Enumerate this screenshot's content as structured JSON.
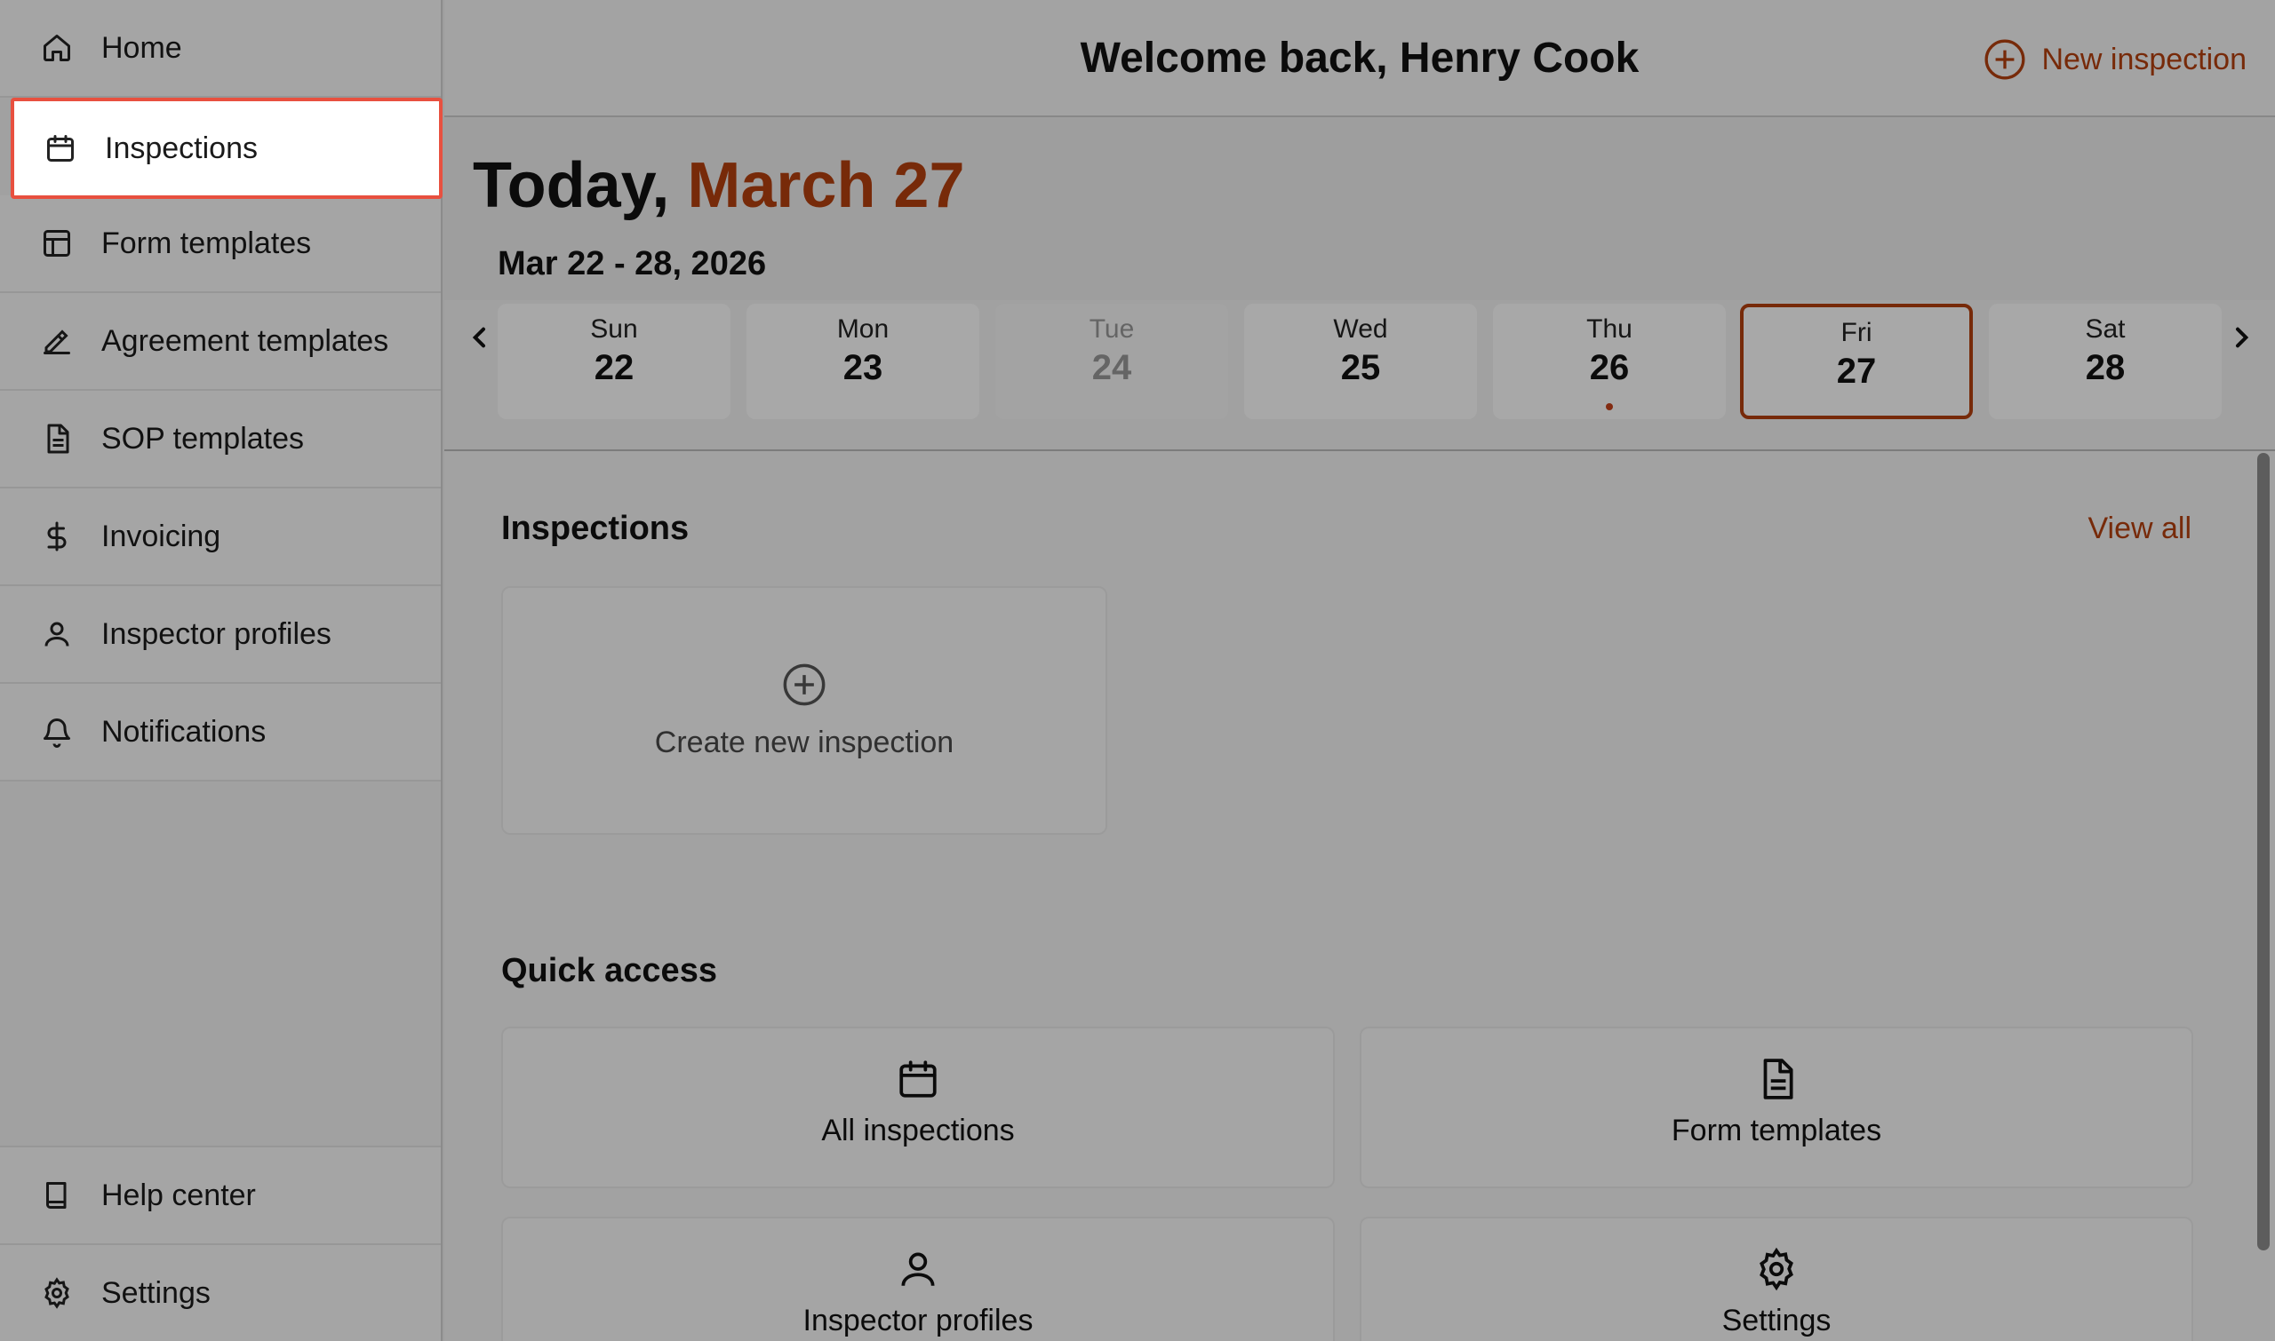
{
  "sidebar": {
    "items": [
      {
        "label": "Home",
        "icon": "home-icon"
      },
      {
        "label": "Inspections",
        "icon": "calendar-icon",
        "active": true
      },
      {
        "label": "Form templates",
        "icon": "layout-icon"
      },
      {
        "label": "Agreement templates",
        "icon": "signature-icon"
      },
      {
        "label": "SOP templates",
        "icon": "document-icon"
      },
      {
        "label": "Invoicing",
        "icon": "dollar-icon"
      },
      {
        "label": "Inspector profiles",
        "icon": "user-icon"
      },
      {
        "label": "Notifications",
        "icon": "bell-icon"
      }
    ],
    "bottom_items": [
      {
        "label": "Help center",
        "icon": "book-icon"
      },
      {
        "label": "Settings",
        "icon": "gear-icon"
      }
    ]
  },
  "header": {
    "welcome": "Welcome back, Henry Cook",
    "new_inspection_label": "New inspection"
  },
  "today": {
    "prefix": "Today,",
    "date": "March 27"
  },
  "week": {
    "range": "Mar 22 - 28, 2026",
    "days": [
      {
        "name": "Sun",
        "date": "22",
        "state": "normal"
      },
      {
        "name": "Mon",
        "date": "23",
        "state": "normal"
      },
      {
        "name": "Tue",
        "date": "24",
        "state": "muted"
      },
      {
        "name": "Wed",
        "date": "25",
        "state": "normal"
      },
      {
        "name": "Thu",
        "date": "26",
        "state": "normal",
        "has_event": true
      },
      {
        "name": "Fri",
        "date": "27",
        "state": "selected"
      },
      {
        "name": "Sat",
        "date": "28",
        "state": "normal"
      }
    ]
  },
  "inspections": {
    "title": "Inspections",
    "view_all": "View all",
    "create_label": "Create new inspection"
  },
  "quick_access": {
    "title": "Quick access",
    "items": [
      {
        "label": "All inspections",
        "icon": "calendar-icon"
      },
      {
        "label": "Form templates",
        "icon": "document-icon"
      },
      {
        "label": "Inspector profiles",
        "icon": "user-icon"
      },
      {
        "label": "Settings",
        "icon": "gear-icon"
      }
    ]
  },
  "colors": {
    "accent": "#b5400f",
    "highlight_border": "#e8503f",
    "overlay": "rgba(0,0,0,0.34)"
  }
}
